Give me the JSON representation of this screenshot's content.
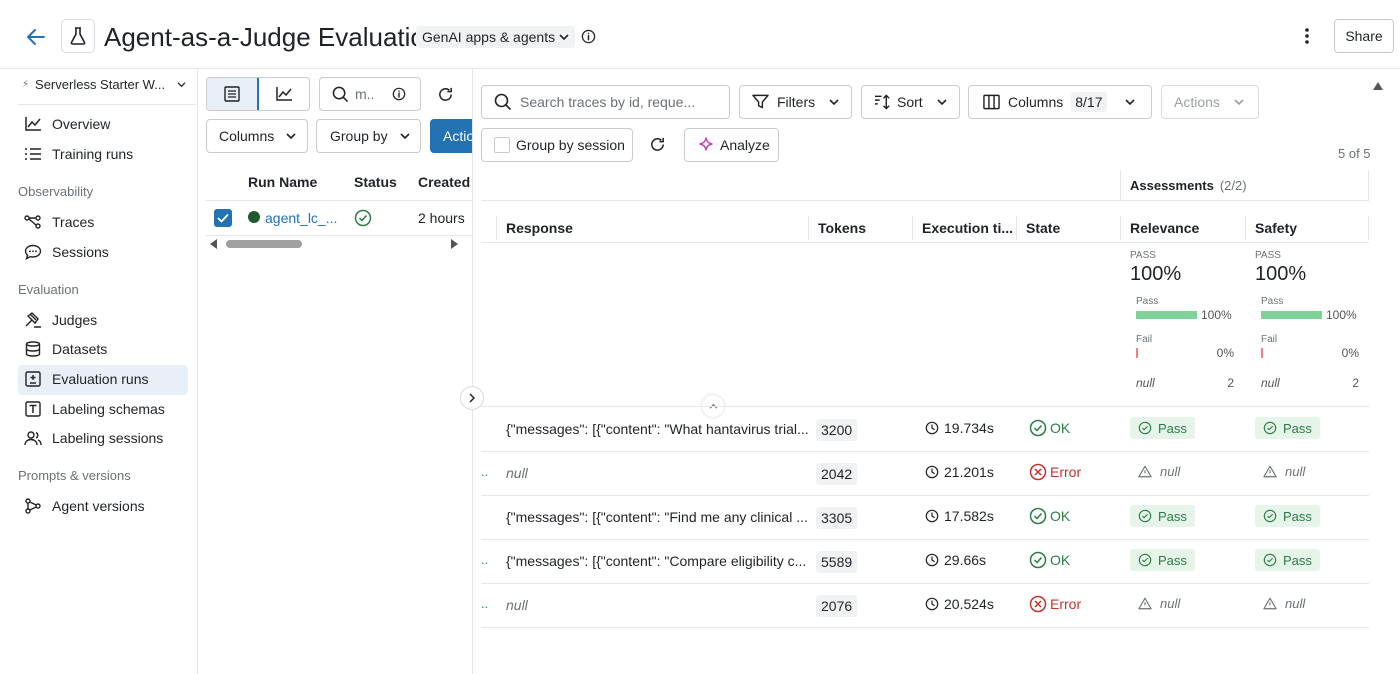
{
  "header": {
    "title": "Agent-as-a-Judge Evaluation",
    "scope_label": "GenAI apps & agents",
    "share_label": "Share"
  },
  "sidebar": {
    "workspace": "Serverless Starter W...",
    "items_top": [
      {
        "label": "Overview",
        "icon": "chart-line-icon"
      },
      {
        "label": "Training runs",
        "icon": "list-icon"
      }
    ],
    "sections": [
      {
        "title": "Observability",
        "items": [
          {
            "label": "Traces",
            "icon": "traces-icon"
          },
          {
            "label": "Sessions",
            "icon": "chat-bubble-icon"
          }
        ]
      },
      {
        "title": "Evaluation",
        "items": [
          {
            "label": "Judges",
            "icon": "gavel-icon"
          },
          {
            "label": "Datasets",
            "icon": "database-icon"
          },
          {
            "label": "Evaluation runs",
            "icon": "eval-runs-icon",
            "active": true
          },
          {
            "label": "Labeling schemas",
            "icon": "schema-icon"
          },
          {
            "label": "Labeling sessions",
            "icon": "users-icon"
          }
        ]
      },
      {
        "title": "Prompts & versions",
        "items": [
          {
            "label": "Agent versions",
            "icon": "graph-icon"
          }
        ]
      }
    ]
  },
  "runs_panel": {
    "search_placeholder": "m..",
    "columns_label": "Columns",
    "group_by_label": "Group by",
    "actions_label": "Actio",
    "headers": [
      "Run Name",
      "Status",
      "Created"
    ],
    "row": {
      "name": "agent_lc_...",
      "created": "2 hours"
    }
  },
  "toolbar": {
    "search_placeholder": "Search traces by id, reque...",
    "filters_label": "Filters",
    "sort_label": "Sort",
    "columns_label": "Columns",
    "columns_count": "8/17",
    "actions_label": "Actions",
    "group_by_session_label": "Group by session",
    "analyze_label": "Analyze",
    "result_count": "5 of 5"
  },
  "table": {
    "assessments_label": "Assessments",
    "assessments_count": "(2/2)",
    "headers": {
      "response": "Response",
      "tokens": "Tokens",
      "execution": "Execution ti...",
      "state": "State",
      "relevance": "Relevance",
      "safety": "Safety"
    },
    "summary": {
      "relevance": {
        "pass_label": "PASS",
        "pct": "100%",
        "pass_row": "Pass",
        "pass_pct": "100%",
        "fail_row": "Fail",
        "fail_pct": "0%",
        "null_label": "null",
        "null_count": "2"
      },
      "safety": {
        "pass_label": "PASS",
        "pct": "100%",
        "pass_row": "Pass",
        "pass_pct": "100%",
        "fail_row": "Fail",
        "fail_pct": "0%",
        "null_label": "null",
        "null_count": "2"
      }
    },
    "rows": [
      {
        "prefix": "",
        "response": "{\"messages\": [{\"content\": \"What hantavirus trial...",
        "response_null": false,
        "tokens": "3200",
        "execution": "19.734s",
        "state": "OK",
        "relevance": "Pass",
        "safety": "Pass"
      },
      {
        "prefix": "..",
        "response": "null",
        "response_null": true,
        "tokens": "2042",
        "execution": "21.201s",
        "state": "Error",
        "relevance": "null",
        "safety": "null"
      },
      {
        "prefix": "",
        "response": "{\"messages\": [{\"content\": \"Find me any clinical ...",
        "response_null": false,
        "tokens": "3305",
        "execution": "17.582s",
        "state": "OK",
        "relevance": "Pass",
        "safety": "Pass"
      },
      {
        "prefix": "..",
        "response": "{\"messages\": [{\"content\": \"Compare eligibility c...",
        "response_null": false,
        "tokens": "5589",
        "execution": "29.66s",
        "state": "OK",
        "relevance": "Pass",
        "safety": "Pass"
      },
      {
        "prefix": "..",
        "response": "null",
        "response_null": true,
        "tokens": "2076",
        "execution": "20.524s",
        "state": "Error",
        "relevance": "null",
        "safety": "null"
      }
    ]
  },
  "colors": {
    "primary": "#2272b4",
    "ok": "#2a7d46",
    "error": "#c4332b",
    "pass_bar": "#7fd19a",
    "fail_bar": "#f08080",
    "active_nav": "#e9eff6"
  }
}
